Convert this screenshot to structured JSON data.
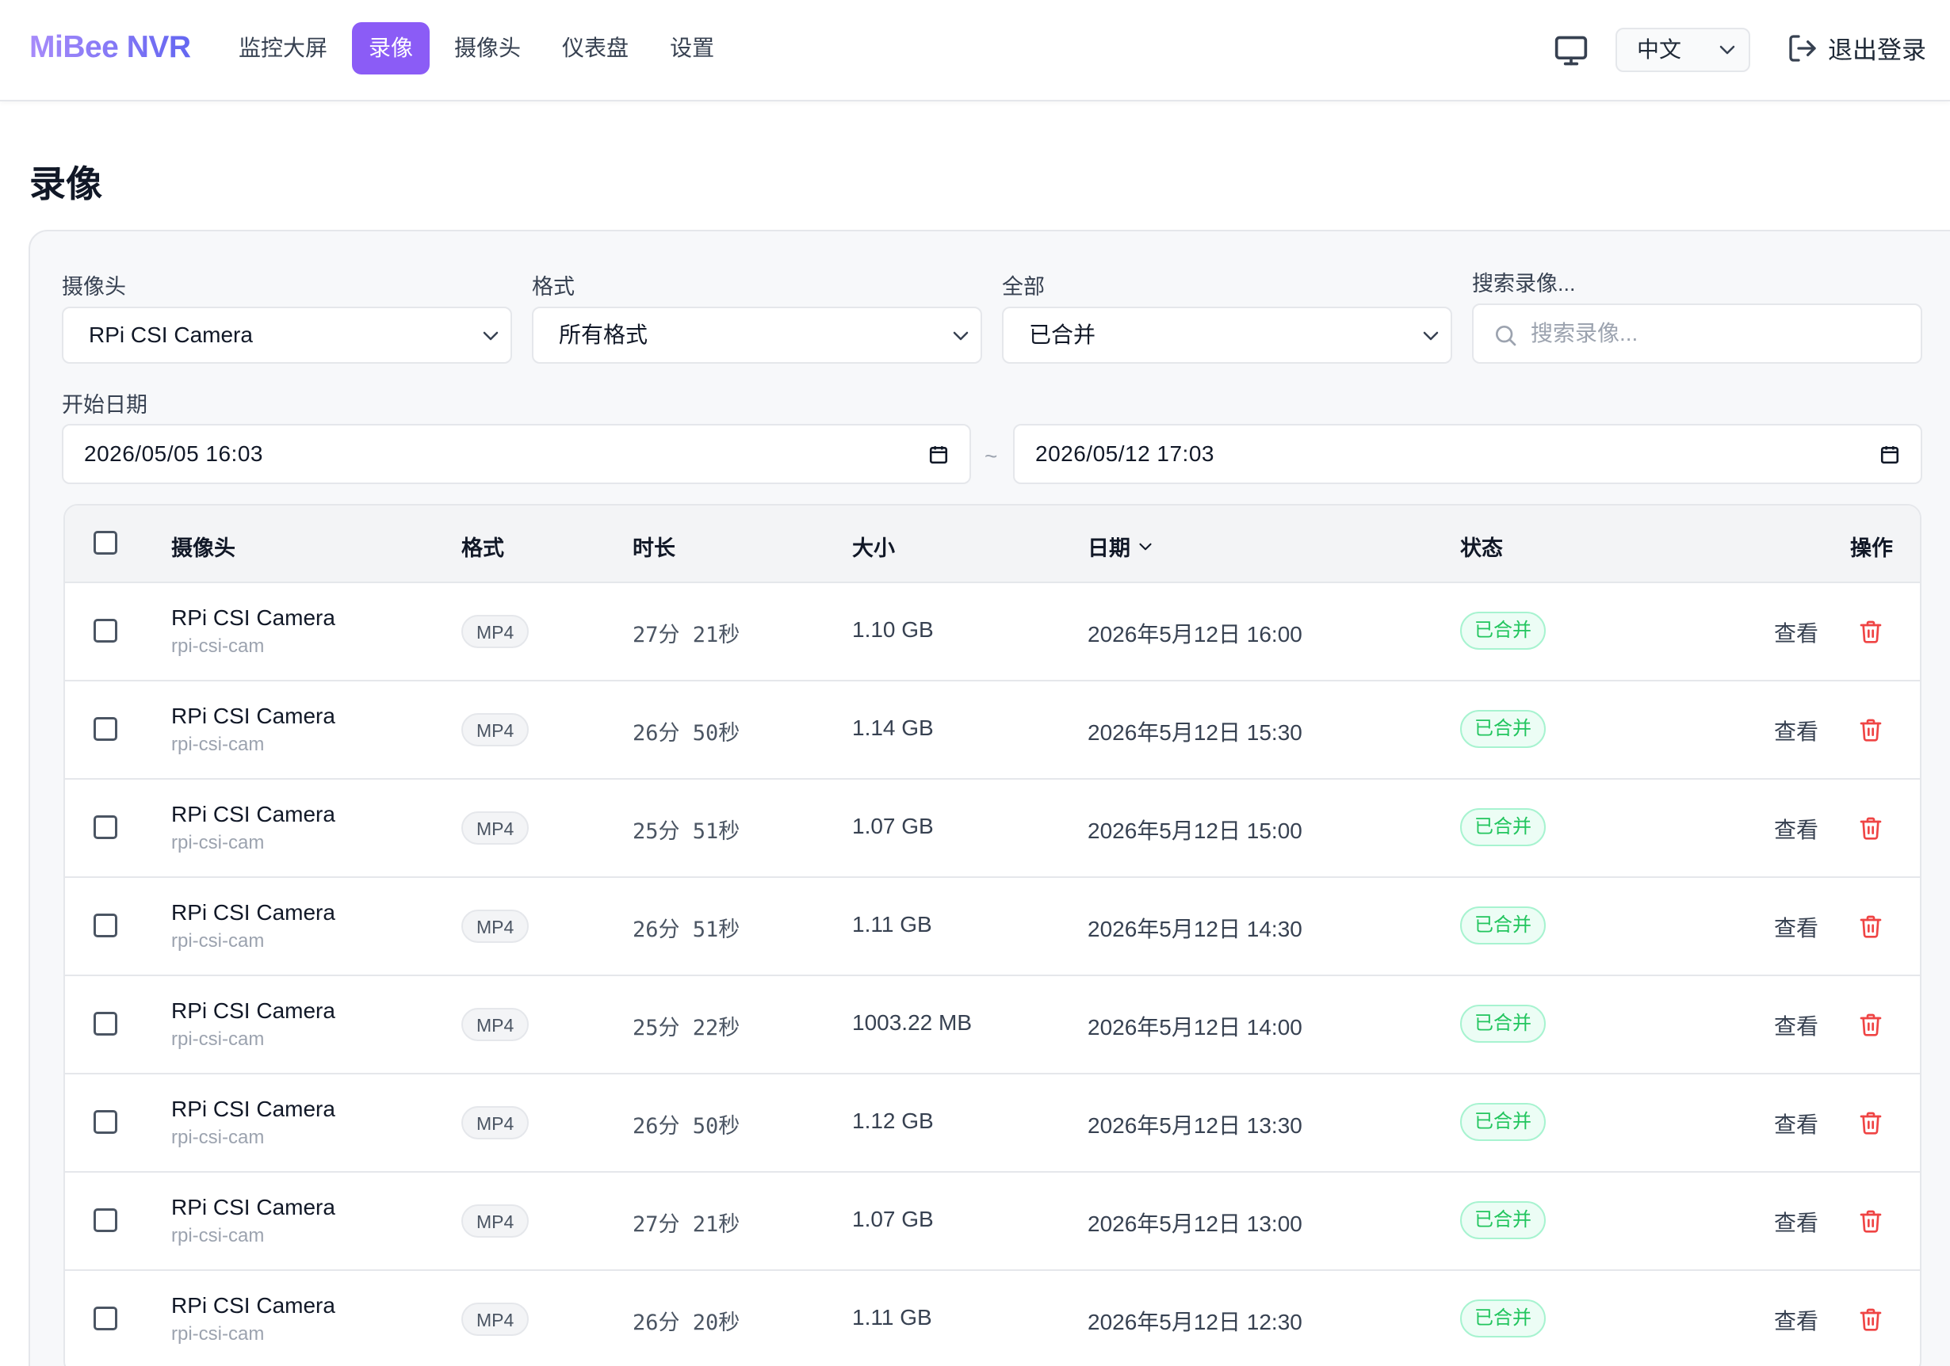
{
  "app": {
    "brand": "MiBee NVR"
  },
  "nav": {
    "items": [
      {
        "label": "监控大屏",
        "active": false
      },
      {
        "label": "录像",
        "active": true
      },
      {
        "label": "摄像头",
        "active": false
      },
      {
        "label": "仪表盘",
        "active": false
      },
      {
        "label": "设置",
        "active": false
      }
    ]
  },
  "header": {
    "language": "中文",
    "logout_label": "退出登录",
    "monitor_icon": "monitor-icon",
    "logout_icon": "logout-icon"
  },
  "page": {
    "title": "录像"
  },
  "filters": {
    "camera": {
      "label": "摄像头",
      "value": "RPi CSI Camera"
    },
    "format": {
      "label": "格式",
      "value": "所有格式"
    },
    "merge": {
      "label": "全部",
      "value": "已合并"
    },
    "search": {
      "label": "搜索录像...",
      "placeholder": "搜索录像..."
    },
    "start_label": "开始日期",
    "start_date": "2026/05/05 16:03",
    "separator": "~",
    "end_date": "2026/05/12 17:03"
  },
  "table": {
    "headers": {
      "camera": "摄像头",
      "format": "格式",
      "duration": "时长",
      "size": "大小",
      "date": "日期",
      "status": "状态",
      "actions": "操作"
    },
    "view_label": "查看",
    "rows": [
      {
        "camera": "RPi CSI Camera",
        "camera_id": "rpi-csi-cam",
        "format": "MP4",
        "duration": "27分 21秒",
        "size": "1.10 GB",
        "date": "2026年5月12日 16:00",
        "status": "已合并"
      },
      {
        "camera": "RPi CSI Camera",
        "camera_id": "rpi-csi-cam",
        "format": "MP4",
        "duration": "26分 50秒",
        "size": "1.14 GB",
        "date": "2026年5月12日 15:30",
        "status": "已合并"
      },
      {
        "camera": "RPi CSI Camera",
        "camera_id": "rpi-csi-cam",
        "format": "MP4",
        "duration": "25分 51秒",
        "size": "1.07 GB",
        "date": "2026年5月12日 15:00",
        "status": "已合并"
      },
      {
        "camera": "RPi CSI Camera",
        "camera_id": "rpi-csi-cam",
        "format": "MP4",
        "duration": "26分 51秒",
        "size": "1.11 GB",
        "date": "2026年5月12日 14:30",
        "status": "已合并"
      },
      {
        "camera": "RPi CSI Camera",
        "camera_id": "rpi-csi-cam",
        "format": "MP4",
        "duration": "25分 22秒",
        "size": "1003.22 MB",
        "date": "2026年5月12日 14:00",
        "status": "已合并"
      },
      {
        "camera": "RPi CSI Camera",
        "camera_id": "rpi-csi-cam",
        "format": "MP4",
        "duration": "26分 50秒",
        "size": "1.12 GB",
        "date": "2026年5月12日 13:30",
        "status": "已合并"
      },
      {
        "camera": "RPi CSI Camera",
        "camera_id": "rpi-csi-cam",
        "format": "MP4",
        "duration": "27分 21秒",
        "size": "1.07 GB",
        "date": "2026年5月12日 13:00",
        "status": "已合并"
      },
      {
        "camera": "RPi CSI Camera",
        "camera_id": "rpi-csi-cam",
        "format": "MP4",
        "duration": "26分 20秒",
        "size": "1.11 GB",
        "date": "2026年5月12日 12:30",
        "status": "已合并"
      }
    ]
  },
  "colors": {
    "accent": "#8b5cf6",
    "status_green": "#22c55e",
    "delete_red": "#ef4444"
  }
}
